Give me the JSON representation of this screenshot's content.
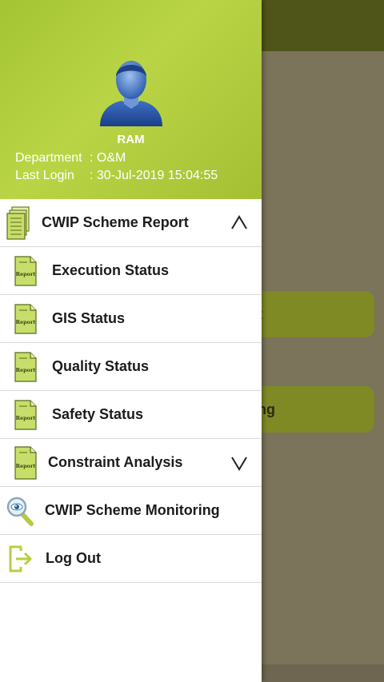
{
  "background": {
    "button1_text": "t",
    "button2_text": "ng"
  },
  "header": {
    "user_name": "RAM",
    "department_label": "Department",
    "department_value": ": O&M",
    "last_login_label": "Last Login",
    "last_login_value": ": 30-Jul-2019 15:04:55"
  },
  "menu": {
    "cwip_report": "CWIP Scheme Report",
    "execution_status": "Execution Status",
    "gis_status": "GIS Status",
    "quality_status": "Quality Status",
    "safety_status": "Safety Status",
    "constraint_analysis": "Constraint Analysis",
    "cwip_monitoring": "CWIP Scheme Monitoring",
    "log_out": "Log Out",
    "report_icon_text": "Report"
  },
  "colors": {
    "header_green": "#b9d545",
    "topbar_dark": "#4f5418"
  }
}
